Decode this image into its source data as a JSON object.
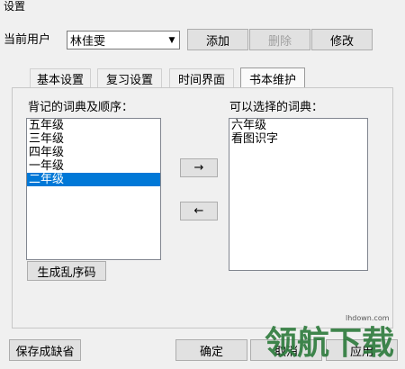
{
  "window": {
    "title": "设置"
  },
  "user": {
    "label": "当前用户",
    "selected": "林佳雯",
    "add_label": "添加",
    "delete_label": "删除",
    "modify_label": "修改"
  },
  "tabs": [
    {
      "label": "基本设置",
      "active": false
    },
    {
      "label": "复习设置",
      "active": false
    },
    {
      "label": "时间界面",
      "active": false
    },
    {
      "label": "书本维护",
      "active": true
    }
  ],
  "left_list": {
    "label": "背记的词典及顺序：",
    "items": [
      "五年级",
      "三年级",
      "四年级",
      "一年级",
      "二年级"
    ],
    "selected_index": 4
  },
  "right_list": {
    "label": "可以选择的词典：",
    "items": [
      "六年级",
      "看图识字"
    ]
  },
  "move_right_label": "→",
  "move_left_label": "←",
  "shuffle_label": "生成乱序码",
  "footer": {
    "save_default_label": "保存成缺省",
    "ok_label": "确定",
    "cancel_label": "取消",
    "apply_label": "应用"
  },
  "watermark": {
    "text": "领航下载",
    "site": "lhdown.com"
  }
}
